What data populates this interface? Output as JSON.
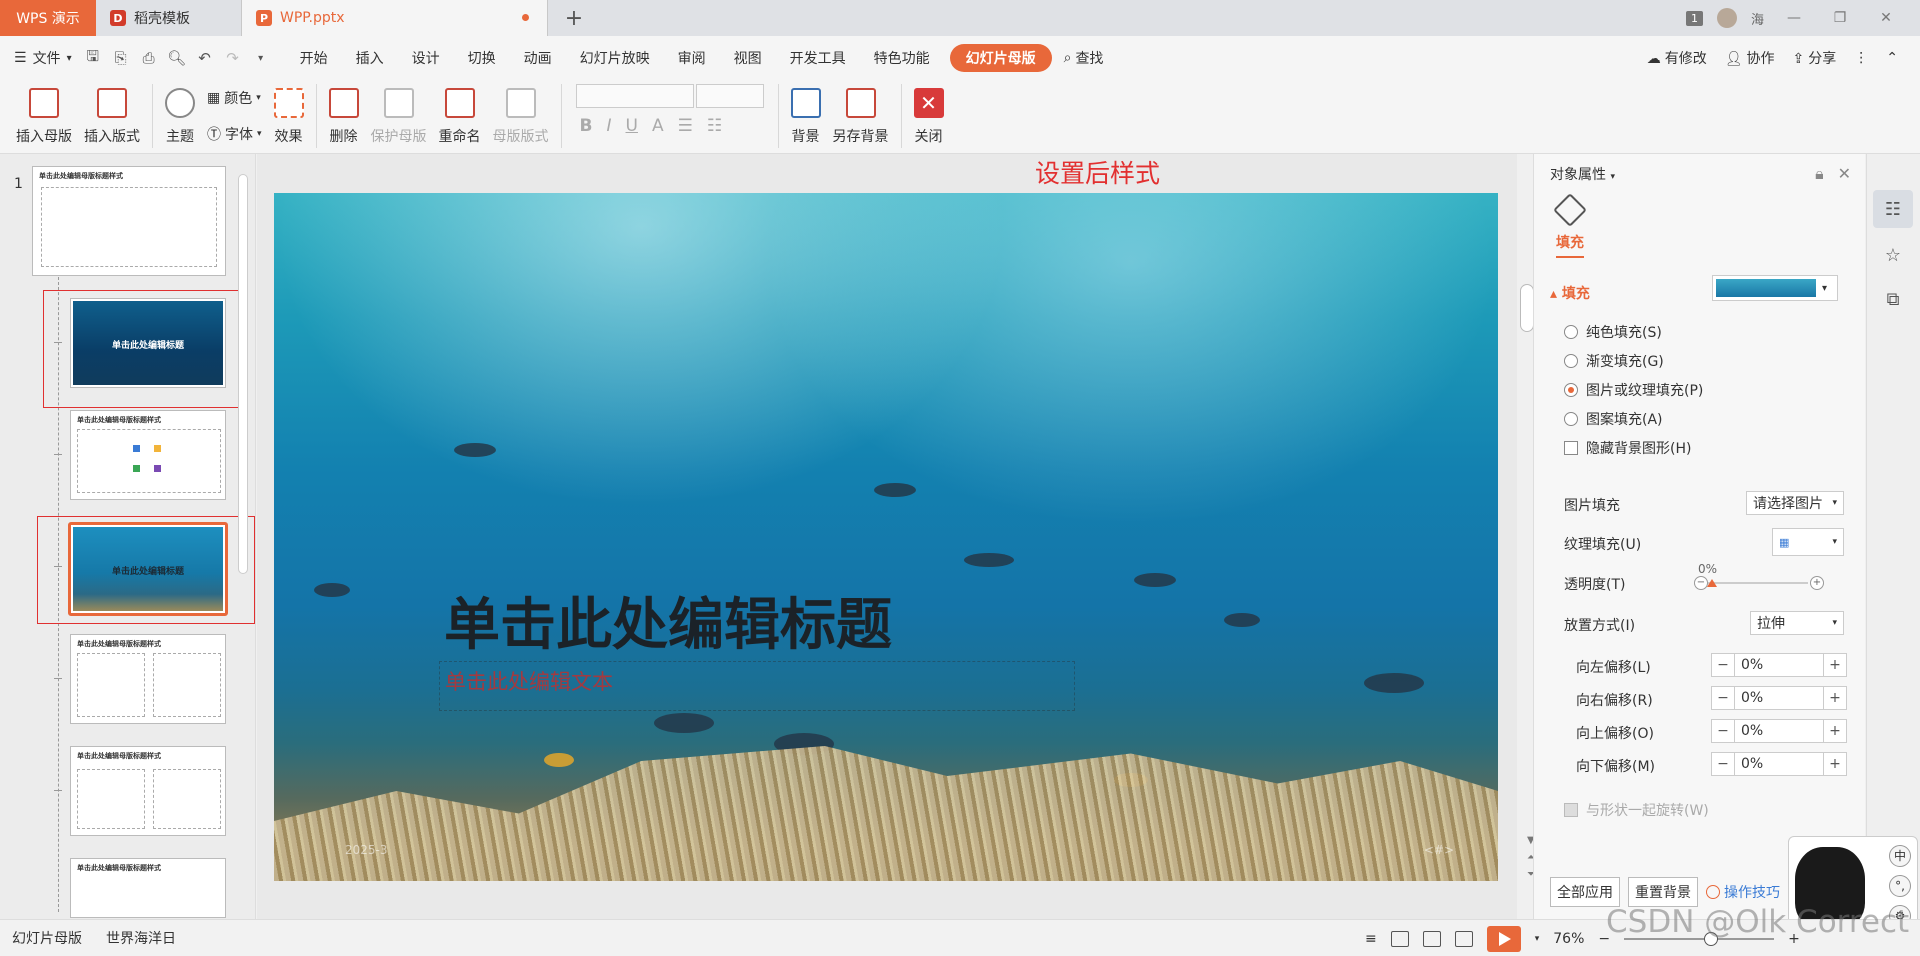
{
  "titlebar": {
    "app_tab": "WPS 演示",
    "tabs": [
      {
        "label": "稻壳模板",
        "logo": "D"
      },
      {
        "label": "WPP.pptx",
        "logo": "P"
      }
    ],
    "window_count_badge": "1",
    "user_name": "海"
  },
  "menubar": {
    "file_label": "文件",
    "items": [
      "开始",
      "插入",
      "设计",
      "切换",
      "动画",
      "幻灯片放映",
      "审阅",
      "视图",
      "开发工具",
      "特色功能"
    ],
    "active_item": "幻灯片母版",
    "search_label": "查找",
    "right_items": [
      "有修改",
      "协作",
      "分享"
    ]
  },
  "ribbon": {
    "insert_master": "插入母版",
    "insert_layout": "插入版式",
    "theme": "主题",
    "colors": "颜色",
    "fonts": "字体",
    "effects": "效果",
    "delete": "删除",
    "protect_master": "保护母版",
    "rename": "重命名",
    "master_layout": "母版版式",
    "format_buttons": [
      "B",
      "I",
      "U",
      "A"
    ],
    "background": "背景",
    "save_background": "另存背景",
    "close": "关闭"
  },
  "thumbnails": {
    "slide_number": "1",
    "master_title": "单击此处编辑母版标题样式",
    "cover_title": "单击此处编辑标题",
    "small_title": "单击此处编辑标题"
  },
  "annotation": "设置后样式",
  "slide": {
    "title": "单击此处编辑标题",
    "subtitle": "单击此处编辑文本",
    "date": "2025-3",
    "number": "<#>"
  },
  "right_panel": {
    "header": "对象属性",
    "tab_fill": "填充",
    "section_fill": "填充",
    "options": [
      {
        "label": "纯色填充(S)",
        "selected": false
      },
      {
        "label": "渐变填充(G)",
        "selected": false
      },
      {
        "label": "图片或纹理填充(P)",
        "selected": true
      },
      {
        "label": "图案填充(A)",
        "selected": false
      }
    ],
    "hide_bg_graphics": "隐藏背景图形(H)",
    "picture_fill_label": "图片填充",
    "picture_fill_value": "请选择图片",
    "texture_fill_label": "纹理填充(U)",
    "transparency_label": "透明度(T)",
    "transparency_value": "0%",
    "placement_label": "放置方式(I)",
    "placement_value": "拉伸",
    "offsets": [
      {
        "label": "向左偏移(L)",
        "value": "0%"
      },
      {
        "label": "向右偏移(R)",
        "value": "0%"
      },
      {
        "label": "向上偏移(O)",
        "value": "0%"
      },
      {
        "label": "向下偏移(M)",
        "value": "0%"
      }
    ],
    "rotate_with_shape": "与形状一起旋转(W)",
    "apply_all": "全部应用",
    "reset_background": "重置背景",
    "tips_link": "操作技巧"
  },
  "ime": {
    "mode": "中",
    "punct": "°,"
  },
  "statusbar": {
    "mode": "幻灯片母版",
    "theme_name": "世界海洋日",
    "zoom": "76%"
  },
  "watermark": "CSDN @Olk Correct"
}
